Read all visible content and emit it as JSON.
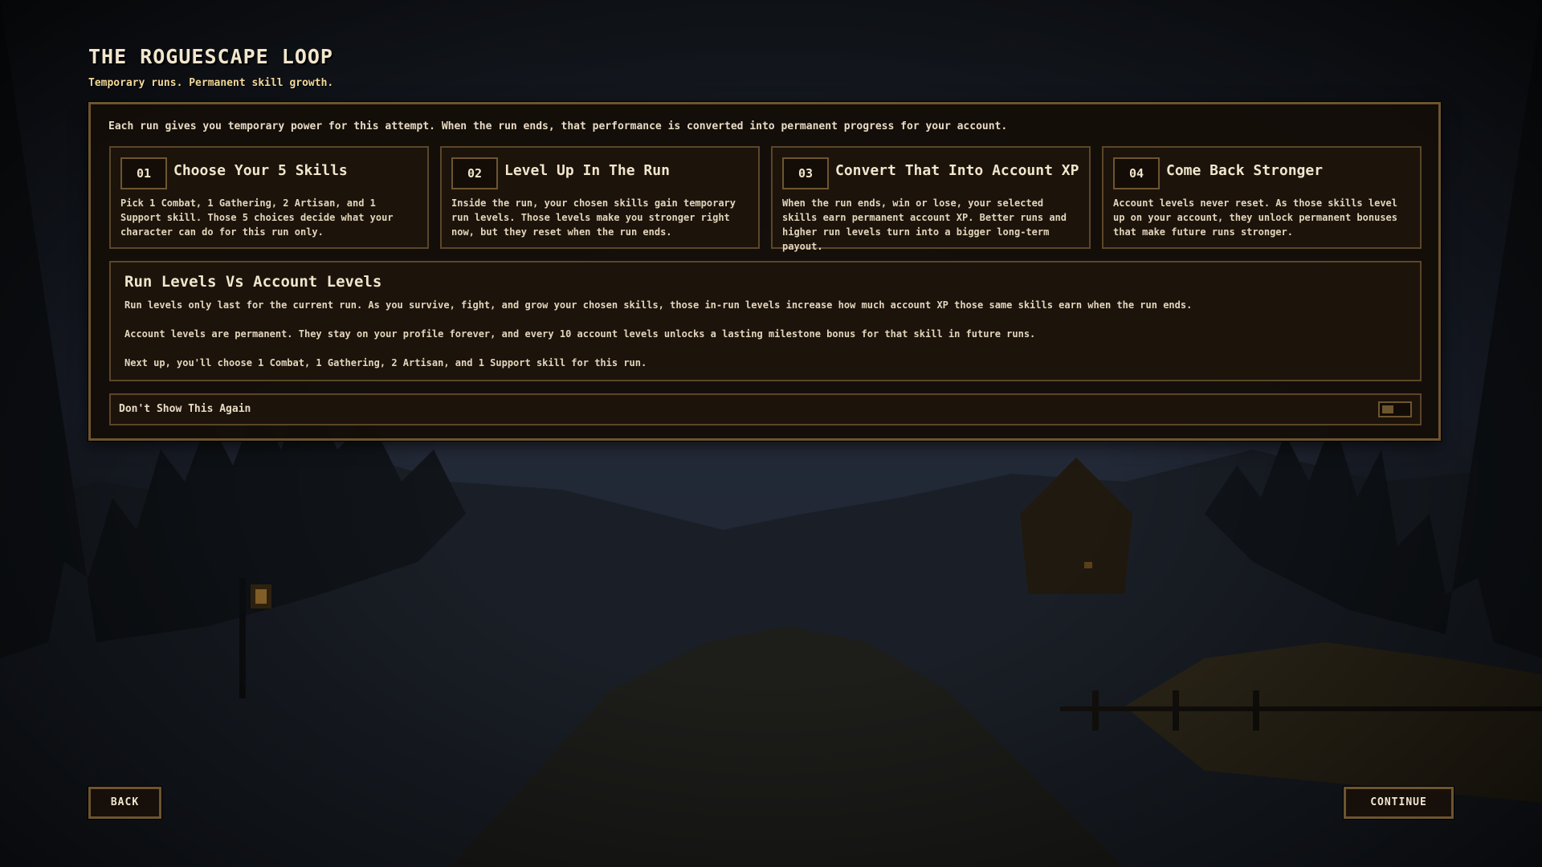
{
  "header": {
    "title": "THE ROGUESCAPE LOOP",
    "subtitle": "Temporary runs. Permanent skill growth."
  },
  "panel": {
    "intro": "Each run gives you temporary power for this attempt. When the run ends, that performance is converted into permanent progress for your account.",
    "steps": [
      {
        "number": "01",
        "title": "Choose Your 5 Skills",
        "description": "Pick 1 Combat, 1 Gathering, 2 Artisan, and 1 Support skill. Those 5 choices decide what your character can do for this run only."
      },
      {
        "number": "02",
        "title": "Level Up In The Run",
        "description": "Inside the run, your chosen skills gain temporary run levels. Those levels make you stronger right now, but they reset when the run ends."
      },
      {
        "number": "03",
        "title": "Convert That Into Account XP",
        "description": "When the run ends, win or lose, your selected skills earn permanent account XP. Better runs and higher run levels turn into a bigger long-term payout."
      },
      {
        "number": "04",
        "title": "Come Back Stronger",
        "description": "Account levels never reset. As those skills level up on your account, they unlock permanent bonuses that make future runs stronger."
      }
    ],
    "levels": {
      "title": "Run Levels Vs Account Levels",
      "paragraphs": [
        "Run levels only last for the current run. As you survive, fight, and grow your chosen skills, those in-run levels increase how much account XP those same skills earn when the run ends.",
        "Account levels are permanent. They stay on your profile forever, and every 10 account levels unlocks a lasting milestone bonus for that skill in future runs.",
        "Next up, you'll choose 1 Combat, 1 Gathering, 2 Artisan, and 1 Support skill for this run."
      ]
    },
    "dont_show_again": {
      "label": "Don't Show This Again",
      "checked": false
    }
  },
  "footer": {
    "back_label": "BACK",
    "continue_label": "CONTINUE"
  },
  "colors": {
    "panel_border": "#6d5530",
    "title_text": "#f1e6cc",
    "subtitle_text": "#f3d999"
  }
}
